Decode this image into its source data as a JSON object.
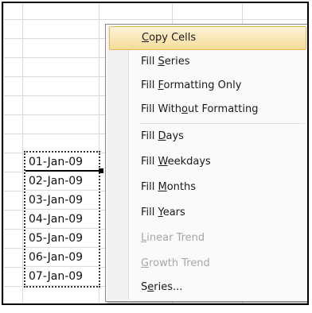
{
  "cells": [
    "01-Jan-09",
    "02-Jan-09",
    "03-Jan-09",
    "04-Jan-09",
    "05-Jan-09",
    "06-Jan-09",
    "07-Jan-09"
  ],
  "menu": {
    "items": [
      {
        "pre": "",
        "u": "C",
        "post": "opy Cells",
        "state": "highlighted"
      },
      {
        "pre": "Fill ",
        "u": "S",
        "post": "eries",
        "state": "enabled"
      },
      {
        "pre": "Fill ",
        "u": "F",
        "post": "ormatting Only",
        "state": "enabled"
      },
      {
        "pre": "Fill With",
        "u": "o",
        "post": "ut Formatting",
        "state": "enabled"
      },
      {
        "pre": "Fill ",
        "u": "D",
        "post": "ays",
        "state": "enabled"
      },
      {
        "pre": "Fill ",
        "u": "W",
        "post": "eekdays",
        "state": "enabled"
      },
      {
        "pre": "Fill ",
        "u": "M",
        "post": "onths",
        "state": "enabled"
      },
      {
        "pre": "Fill ",
        "u": "Y",
        "post": "ears",
        "state": "enabled"
      },
      {
        "pre": "",
        "u": "L",
        "post": "inear Trend",
        "state": "disabled"
      },
      {
        "pre": "",
        "u": "G",
        "post": "rowth Trend",
        "state": "disabled"
      },
      {
        "pre": "S",
        "u": "e",
        "post": "ries...",
        "state": "enabled"
      }
    ]
  },
  "colors": {
    "highlight": "#f6dc9a",
    "disabled_text": "#a7a7a7",
    "gridline": "#d8dde4"
  }
}
